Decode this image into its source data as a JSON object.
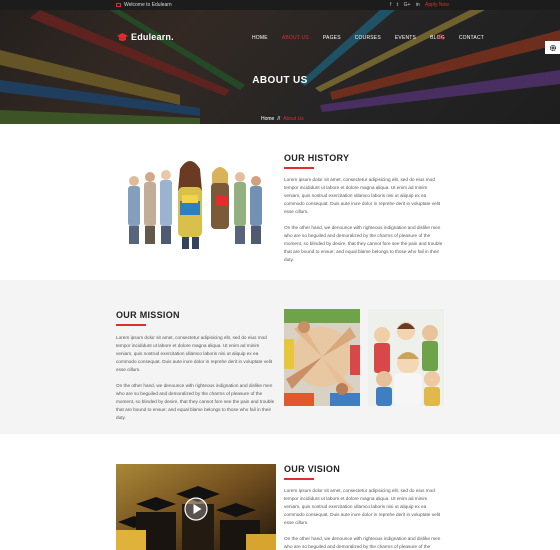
{
  "topbar": {
    "welcome": "Welcome to Edulearn",
    "social": [
      "f",
      "t",
      "G+",
      "in"
    ],
    "apply": "Apply Now"
  },
  "brand": {
    "name": "Edulearn."
  },
  "nav": {
    "items": [
      "HOME",
      "ABOUT US",
      "PAGES",
      "COURSES",
      "EVENTS",
      "BLOG",
      "CONTACT"
    ],
    "active": "ABOUT US"
  },
  "hero": {
    "title": "ABOUT US",
    "breadcrumb": {
      "home": "Home",
      "sep": "//",
      "current": "About Us"
    }
  },
  "history": {
    "title": "OUR HISTORY",
    "p1": "Lorem ipsum dolor sit amet, consectetur adipisicing elit, sed do eius mod tempor incididunt ut labore et dolore magna aliqua. Ut enim ad minim veniam, quis nostrud exercitation ullamco laboris nisi ut aliquip ex ea commodo consequat. Duis aute irure dolor in reprehe derit in voluptate velit esse cillum.",
    "p2": "On the other hand, we denounce with righteous indignation and dislike men who are so beguiled and demoralized by the charms of pleasure of the moment, so blinded by desire, that they cannot fore see the pain and trouble that are bound to ensue; and equal blame belongs to those who fail in their duty."
  },
  "mission": {
    "title": "OUR MISSION",
    "p1": "Lorem ipsum dolor sit amet, consectetur adipisicing elit, sed do eius mod tempor incididunt ut labore et dolore magna aliqua. Ut enim ad minim veniam, quis nostrud exercitation ullamco laboris nisi ut aliquip ex ea commodo consequat. Duis aute irure dolor in reprehe derit in voluptate velit esse cillum.",
    "p2": "On the other hand, we denounce with righteous indignation and dislike men who are so beguiled and demoralized by the charms of pleasure of the moment, so blinded by desire, that they cannot fore see the pain and trouble that are bound to ensue; and equal blame belongs to those who fail in their duty."
  },
  "vision": {
    "title": "OUR VISION",
    "p1": "Lorem ipsum dolor sit amet, consectetur adipisicing elit, sed do eius mod tempor incididunt ut labore et dolore magna aliqua. Ut enim ad minim veniam, quis nostrud exercitation ullamco laboris nisi ut aliquip ex ea commodo consequat. Duis aute irure dolor in reprehe derit in voluptate velit esse cillum.",
    "p2": "On the other hand, we denounce with righteous indignation and dislike men who are so beguiled and demoralized by the charms of pleasure of the moment, so blinded by desire, that they cannot fore see the pain and trouble that are bound to ensue; and equal blame"
  },
  "colors": {
    "accent": "#e12d2d",
    "dark": "#1c1c1c",
    "panel": "#f4f4f4"
  },
  "icons": [
    "envelope-icon",
    "facebook-icon",
    "twitter-icon",
    "google-plus-icon",
    "linkedin-icon",
    "graduation-cap-icon",
    "search-icon",
    "gear-icon",
    "play-icon"
  ]
}
